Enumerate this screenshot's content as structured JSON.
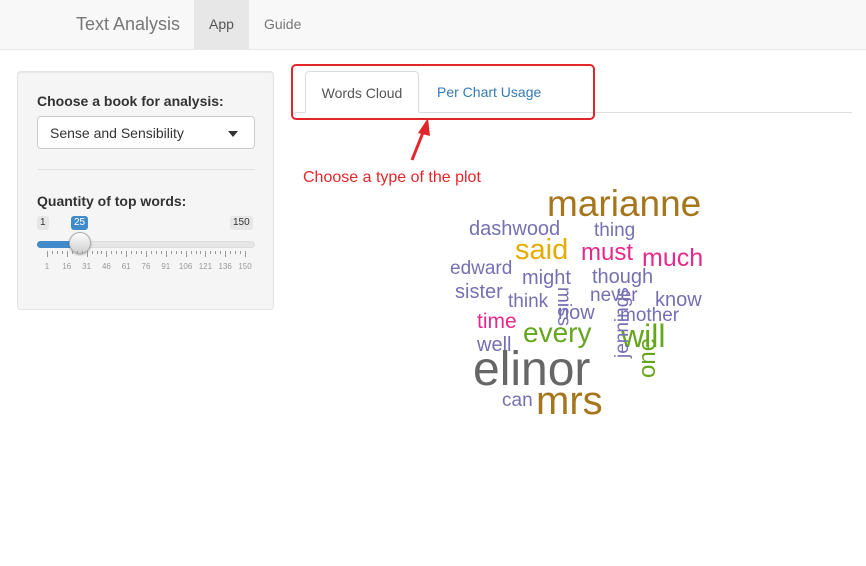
{
  "navbar": {
    "brand": "Text Analysis",
    "tabs": [
      "App",
      "Guide"
    ]
  },
  "sidebar": {
    "book_label": "Choose a book for analysis:",
    "book_selected": "Sense and Sensibility",
    "qty_label": "Quantity of top words:",
    "slider": {
      "min": "1",
      "max": "150",
      "value": "25",
      "tick_labels": [
        "1",
        "16",
        "31",
        "46",
        "61",
        "76",
        "91",
        "106",
        "121",
        "136",
        "150"
      ]
    }
  },
  "tabs": {
    "words_cloud": "Words Cloud",
    "per_chart": "Per Chart Usage"
  },
  "annotation": "Choose a type of the plot",
  "colors": {
    "accent": "#428bca",
    "annotation": "#e3262a"
  },
  "word_cloud": [
    {
      "word": "marianne",
      "color": "#a6761d"
    },
    {
      "word": "dashwood",
      "color": "#7570b3"
    },
    {
      "word": "thing",
      "color": "#7570b3"
    },
    {
      "word": "said",
      "color": "#e6ab02"
    },
    {
      "word": "must",
      "color": "#e7298a"
    },
    {
      "word": "much",
      "color": "#e7298a"
    },
    {
      "word": "edward",
      "color": "#7570b3"
    },
    {
      "word": "might",
      "color": "#7570b3"
    },
    {
      "word": "miss",
      "color": "#7570b3"
    },
    {
      "word": "though",
      "color": "#7570b3"
    },
    {
      "word": "sister",
      "color": "#7570b3"
    },
    {
      "word": "think",
      "color": "#7570b3"
    },
    {
      "word": "never",
      "color": "#7570b3"
    },
    {
      "word": "know",
      "color": "#7570b3"
    },
    {
      "word": "time",
      "color": "#e7298a"
    },
    {
      "word": "now",
      "color": "#7570b3"
    },
    {
      "word": "mother",
      "color": "#7570b3"
    },
    {
      "word": "every",
      "color": "#66a61e"
    },
    {
      "word": "will",
      "color": "#66a61e"
    },
    {
      "word": "well",
      "color": "#7570b3"
    },
    {
      "word": "jennings",
      "color": "#7570b3"
    },
    {
      "word": "elinor",
      "color": "#666666"
    },
    {
      "word": "one",
      "color": "#66a61e"
    },
    {
      "word": "can",
      "color": "#7570b3"
    },
    {
      "word": "mrs",
      "color": "#a6761d"
    }
  ]
}
